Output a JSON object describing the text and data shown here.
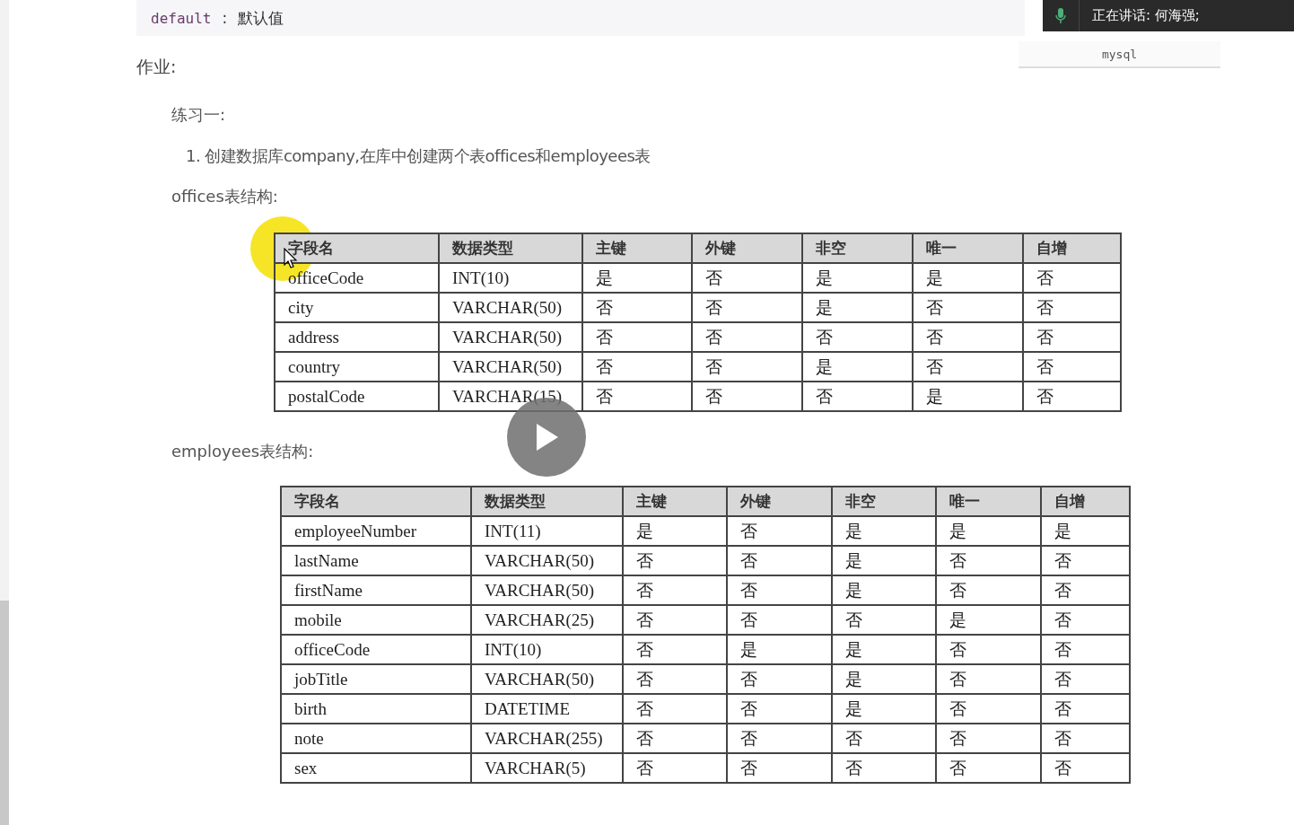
{
  "code_line": {
    "keyword": "default",
    "separator": ":",
    "text": "默认值"
  },
  "speaking_bar": {
    "text": "正在讲话: 何海强;"
  },
  "language_tab": {
    "label": "mysql"
  },
  "heading": "作业:",
  "exercise": "练习一:",
  "task": "1. 创建数据库company,在库中创建两个表offices和employees表",
  "tables": [
    {
      "caption": "offices表结构:",
      "columns": [
        "字段名",
        "数据类型",
        "主键",
        "外键",
        "非空",
        "唯一",
        "自增"
      ],
      "rows": [
        [
          "officeCode",
          "INT(10)",
          "是",
          "否",
          "是",
          "是",
          "否"
        ],
        [
          "city",
          "VARCHAR(50)",
          "否",
          "否",
          "是",
          "否",
          "否"
        ],
        [
          "address",
          "VARCHAR(50)",
          "否",
          "否",
          "否",
          "否",
          "否"
        ],
        [
          "country",
          "VARCHAR(50)",
          "否",
          "否",
          "是",
          "否",
          "否"
        ],
        [
          "postalCode",
          "VARCHAR(15)",
          "否",
          "否",
          "否",
          "是",
          "否"
        ]
      ]
    },
    {
      "caption": "employees表结构:",
      "columns": [
        "字段名",
        "数据类型",
        "主键",
        "外键",
        "非空",
        "唯一",
        "自增"
      ],
      "rows": [
        [
          "employeeNumber",
          "INT(11)",
          "是",
          "否",
          "是",
          "是",
          "是"
        ],
        [
          "lastName",
          "VARCHAR(50)",
          "否",
          "否",
          "是",
          "否",
          "否"
        ],
        [
          "firstName",
          "VARCHAR(50)",
          "否",
          "否",
          "是",
          "否",
          "否"
        ],
        [
          "mobile",
          "VARCHAR(25)",
          "否",
          "否",
          "否",
          "是",
          "否"
        ],
        [
          "officeCode",
          "INT(10)",
          "否",
          "是",
          "是",
          "否",
          "否"
        ],
        [
          "jobTitle",
          "VARCHAR(50)",
          "否",
          "否",
          "是",
          "否",
          "否"
        ],
        [
          "birth",
          "DATETIME",
          "否",
          "否",
          "是",
          "否",
          "否"
        ],
        [
          "note",
          "VARCHAR(255)",
          "否",
          "否",
          "否",
          "否",
          "否"
        ],
        [
          "sex",
          "VARCHAR(5)",
          "否",
          "否",
          "否",
          "否",
          "否"
        ]
      ]
    }
  ]
}
